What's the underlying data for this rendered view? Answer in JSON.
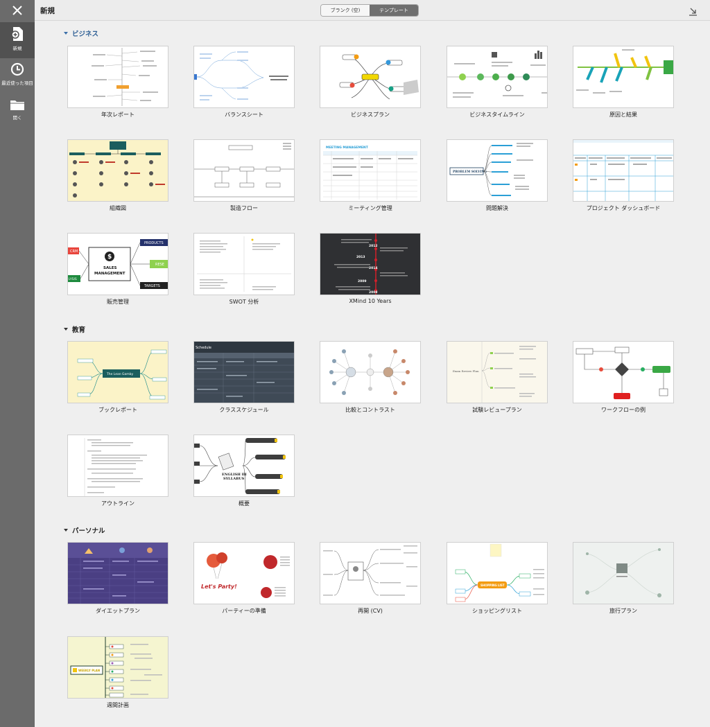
{
  "window": {
    "title": "新規",
    "close_icon": "close-icon",
    "export_icon": "export-icon"
  },
  "sidebar": {
    "items": [
      {
        "label": "新規",
        "icon": "new-file-icon",
        "active": true
      },
      {
        "label": "最近使った項目",
        "icon": "clock-icon",
        "active": false
      },
      {
        "label": "開く",
        "icon": "folder-icon",
        "active": false
      }
    ]
  },
  "segmented": {
    "blank": "ブランク (空)",
    "templates": "テンプレート",
    "selected": "テンプレート"
  },
  "sections": [
    {
      "title": "ビジネス",
      "templates": [
        {
          "label": "年次レポート"
        },
        {
          "label": "バランスシート"
        },
        {
          "label": "ビジネスプラン"
        },
        {
          "label": "ビジネスタイムライン"
        },
        {
          "label": "原因と結果"
        },
        {
          "label": "組織図"
        },
        {
          "label": "製造フロー"
        },
        {
          "label": "ミーティング管理"
        },
        {
          "label": "問題解決"
        },
        {
          "label": "プロジェクト ダッシュボード"
        },
        {
          "label": "販売管理"
        },
        {
          "label": "SWOT 分析"
        },
        {
          "label": "XMind 10 Years"
        }
      ]
    },
    {
      "title": "教育",
      "templates": [
        {
          "label": "ブックレポート"
        },
        {
          "label": "クラススケジュール"
        },
        {
          "label": "比較とコントラスト"
        },
        {
          "label": "試験レビュープラン"
        },
        {
          "label": "ワークフローの例"
        },
        {
          "label": "アウトライン"
        },
        {
          "label": "概要"
        }
      ]
    },
    {
      "title": "パーソナル",
      "templates": [
        {
          "label": "ダイエットプラン"
        },
        {
          "label": "パーティーの準備"
        },
        {
          "label": "再開 (CV)"
        },
        {
          "label": "ショッピングリスト"
        },
        {
          "label": "旅行プラン"
        },
        {
          "label": "週間計画"
        }
      ]
    }
  ],
  "thumb_text": {
    "sales_title": "SALES",
    "sales_title2": "MANAGEMENT",
    "sales_products": "PRODUCTS",
    "sales_targets": "TARGETS",
    "sales_crm": "CRM",
    "sales_lysis": "LYSIS",
    "sales_rese": "RESE",
    "xmind_years": [
      "2012",
      "2013",
      "2014",
      "2009",
      "2008"
    ],
    "meeting_header": "MEETING MANAGEMENT",
    "problem_solving": "PROBLEM SOLVING",
    "book_center": "The Lean Gamby",
    "schedule_header": "Schedule",
    "exam_title": "Exam Review Plan",
    "syllabus1": "ENGLISH III",
    "syllabus2": "SYLLABUS",
    "party": "Let's Party!",
    "weekly": "WEEKLY PLAN",
    "shopping": "SHOPPING LIST"
  },
  "colors": {
    "sidebar_bg": "#6b6b6b",
    "sidebar_active": "#515151",
    "section_blue": "#2e5f95",
    "segment_active": "#6f6f6f"
  }
}
